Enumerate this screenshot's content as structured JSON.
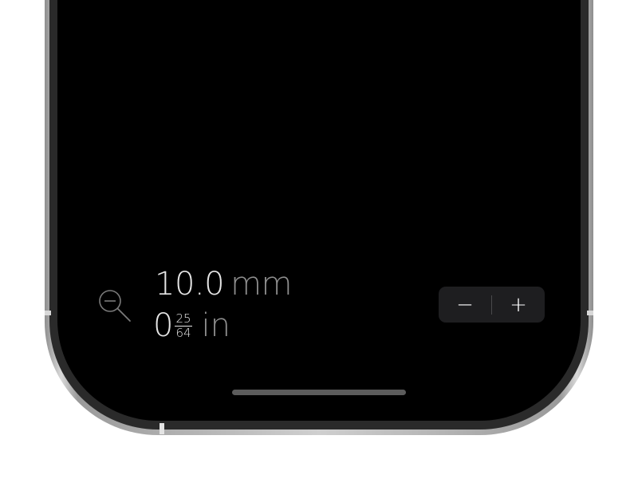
{
  "measurement": {
    "metric_value": "10.0",
    "metric_unit": "mm",
    "imperial_whole": "0",
    "imperial_fraction_numerator": "25",
    "imperial_fraction_denominator": "64",
    "imperial_unit": "in"
  },
  "controls": {
    "zoom_icon": "zoom-out-icon",
    "decrement_label": "−",
    "increment_label": "+"
  },
  "colors": {
    "screen_background": "#000000",
    "value_text": "#e6e6e6",
    "unit_text": "#8e8e8e",
    "stepper_background": "#1e1e20",
    "frame_silver": "#cfcfcf"
  }
}
